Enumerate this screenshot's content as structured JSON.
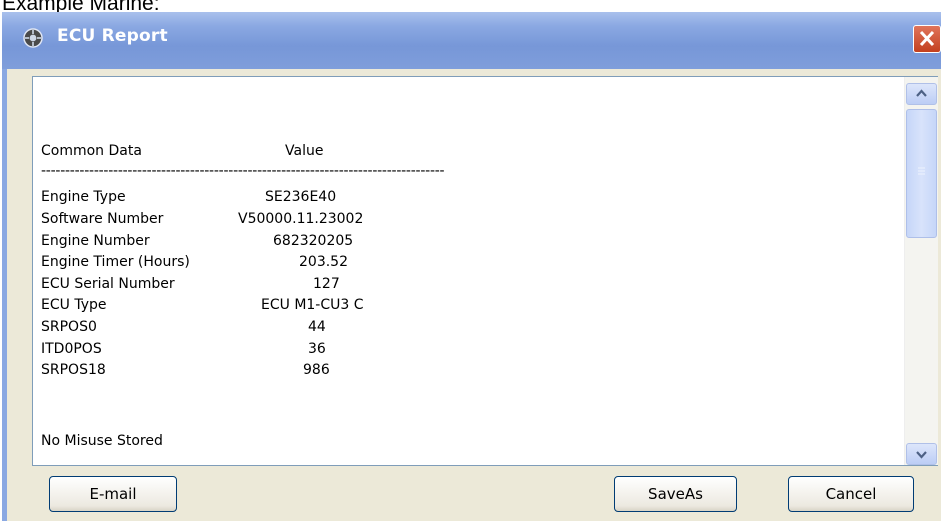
{
  "caption": "Example Marine:",
  "window": {
    "title": "ECU Report"
  },
  "report": {
    "header": {
      "label": "Common Data",
      "value": "Value"
    },
    "separator": "------------------------------------------------------------------------------------",
    "rows": [
      {
        "label": "Engine Type",
        "value": "SE236E40"
      },
      {
        "label": "Software Number",
        "value": "V50000.11.23002"
      },
      {
        "label": "Engine Number",
        "value": "682320205"
      },
      {
        "label": "Engine Timer (Hours)",
        "value": "203.52"
      },
      {
        "label": "ECU Serial Number",
        "value": "127"
      },
      {
        "label": "ECU Type",
        "value": "ECU M1-CU3 C"
      },
      {
        "label": "SRPOS0",
        "value": "44"
      },
      {
        "label": "ITD0POS",
        "value": "36"
      },
      {
        "label": "SRPOS18",
        "value": "986"
      }
    ],
    "footer": "No Misuse Stored"
  },
  "buttons": {
    "email": "E-mail",
    "saveas": "SaveAs",
    "cancel": "Cancel"
  },
  "icons": {
    "title": "gear-icon",
    "close": "close-icon",
    "scroll_up": "arrow-up-icon",
    "scroll_down": "arrow-down-icon"
  },
  "colors": {
    "titlebar": "#7f9edb",
    "close": "#d0502f",
    "border": "#003c74"
  }
}
